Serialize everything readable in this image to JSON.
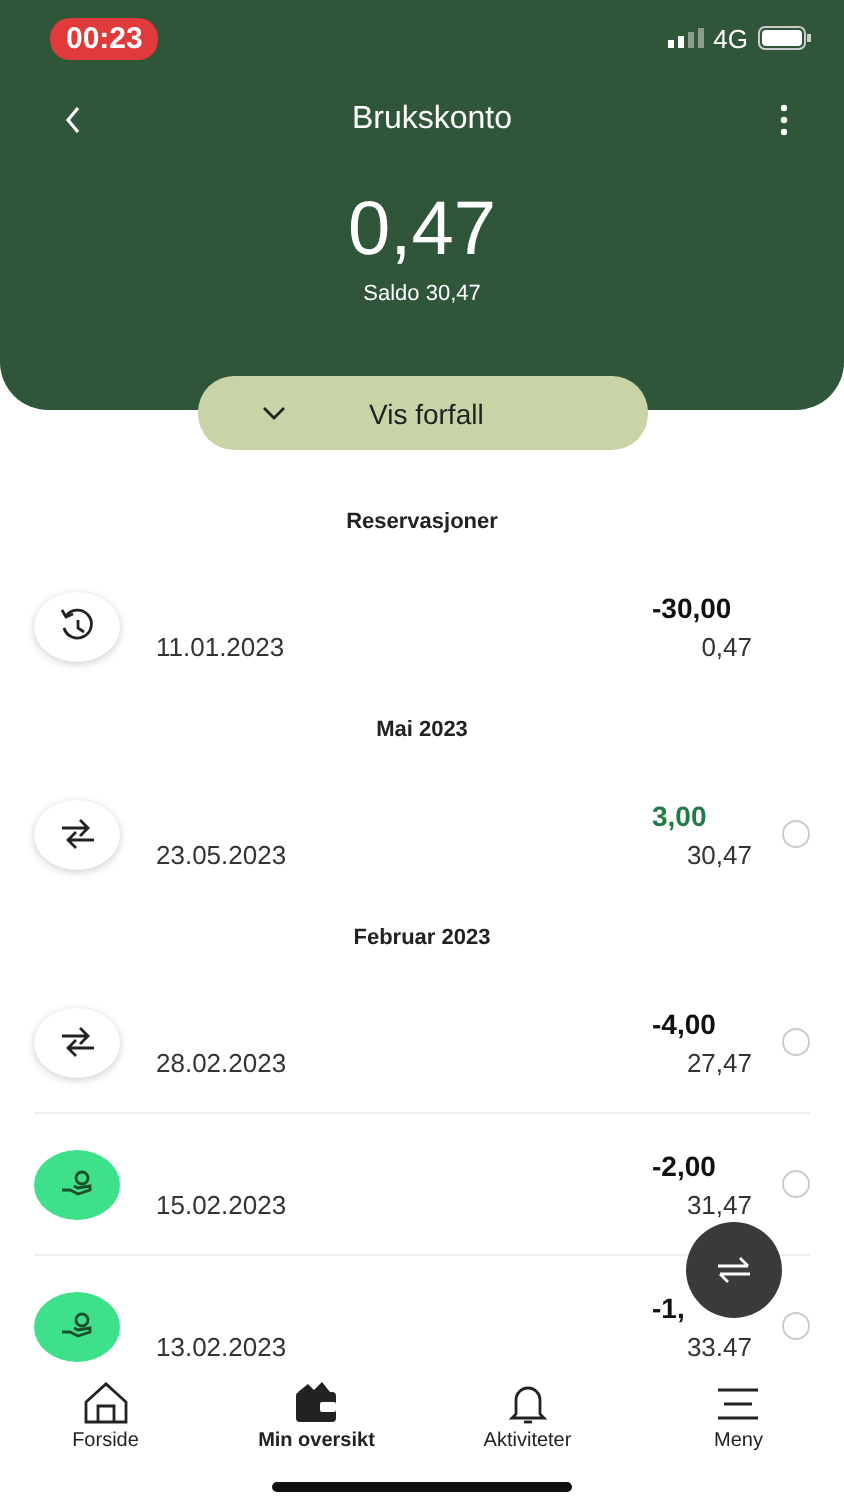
{
  "status_bar": {
    "time": "00:23",
    "network": "4G"
  },
  "header": {
    "title": "Brukskonto",
    "amount": "0,47",
    "balance": "Saldo 30,47"
  },
  "due_button": {
    "label": "Vis forfall",
    "expanded": false
  },
  "sections": [
    {
      "title": "Reservasjoner",
      "rows": [
        {
          "kind": "reservation",
          "date": "11.01.2023",
          "amount": "-30,00",
          "incoming": false,
          "balance": "0,47"
        }
      ]
    },
    {
      "title": "Mai 2023",
      "rows": [
        {
          "kind": "transfer",
          "date": "23.05.2023",
          "amount": "3,00",
          "incoming": true,
          "balance": "30,47",
          "checked": false
        }
      ]
    },
    {
      "title": "Februar 2023",
      "rows": [
        {
          "kind": "transfer",
          "date": "28.02.2023",
          "amount": "-4,00",
          "incoming": false,
          "balance": "27,47",
          "checked": false
        },
        {
          "kind": "payment",
          "date": "15.02.2023",
          "amount": "-2,00",
          "incoming": false,
          "balance": "31,47",
          "checked": false
        },
        {
          "kind": "payment",
          "date": "13.02.2023",
          "amount": "-1,",
          "incoming": false,
          "balance": "33.47",
          "checked": false
        }
      ]
    }
  ],
  "nav": [
    {
      "kind": "home",
      "label": "Forside",
      "selected": false
    },
    {
      "kind": "wallet",
      "label": "Min oversikt",
      "selected": true
    },
    {
      "kind": "bell",
      "label": "Aktiviteter",
      "selected": false
    },
    {
      "kind": "menu",
      "label": "Meny",
      "selected": false
    }
  ]
}
